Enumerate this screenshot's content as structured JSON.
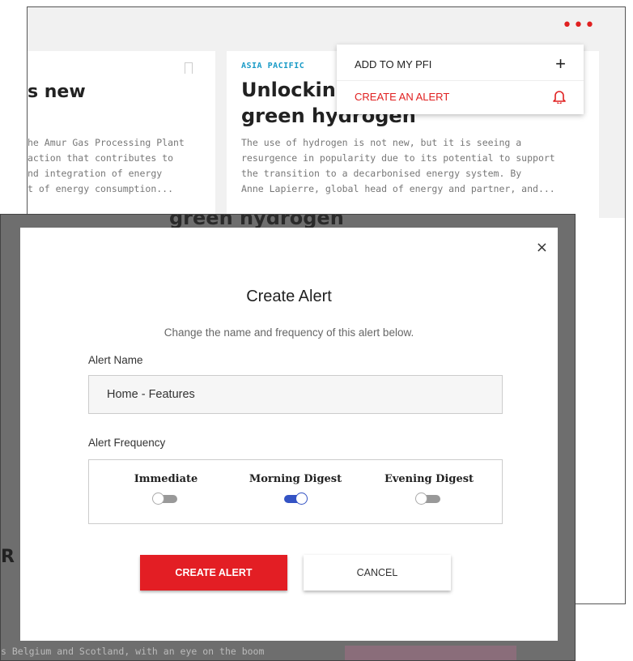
{
  "background": {
    "left_card": {
      "title": "s new",
      "desc_lines": [
        "he Amur Gas Processing Plant",
        "action that contributes to",
        "nd integration of energy",
        "t of energy consumption..."
      ]
    },
    "right_card": {
      "region": "ASIA PACIFIC",
      "title_line1": "Unlockin",
      "title_line2": "green hydrogen",
      "desc_lines": [
        "The use of hydrogen is not new, but it is seeing a",
        "resurgence in popularity due to its potential to support",
        "the transition to a decarbonised energy system. By",
        "Anne Lapierre, global head of energy and partner, and..."
      ]
    },
    "more_icon": "•••",
    "dropdown": {
      "items": [
        {
          "label": "ADD TO MY PFI",
          "icon": "plus-icon"
        },
        {
          "label": "CREATE AN ALERT",
          "icon": "bell-icon"
        }
      ]
    },
    "overlay_title": "green hydrogen",
    "overlay_r": "R",
    "overlay_bottom": "s Belgium and Scotland, with an eye on the boom"
  },
  "modal": {
    "title": "Create Alert",
    "subtitle": "Change the name and frequency of this alert below.",
    "name_label": "Alert Name",
    "name_value": "Home - Features",
    "frequency_label": "Alert Frequency",
    "frequency_options": [
      {
        "label": "Immediate",
        "on": false
      },
      {
        "label": "Morning Digest",
        "on": true
      },
      {
        "label": "Evening Digest",
        "on": false
      }
    ],
    "create_label": "CREATE ALERT",
    "cancel_label": "CANCEL",
    "close_glyph": "×"
  },
  "colors": {
    "accent_red": "#e31e24",
    "toggle_on": "#3453c4",
    "region_blue": "#1a9bc7"
  }
}
